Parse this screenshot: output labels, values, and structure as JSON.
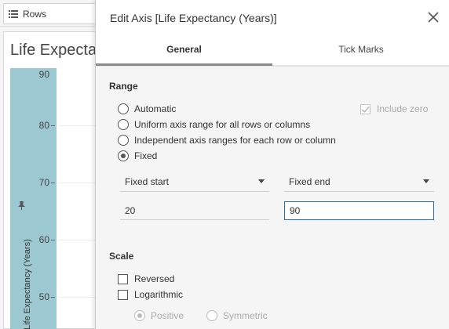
{
  "worksheet": {
    "rows_shelf_label": "Rows",
    "view_title": "Life Expecta",
    "axis_title": "Life Expectancy (Years)",
    "axis_band_color": "#9cc8d2",
    "ticks": [
      "90",
      "80",
      "70",
      "60",
      "50"
    ]
  },
  "dialog": {
    "title": "Edit Axis [Life Expectancy (Years)]",
    "close_icon": "close-icon",
    "tabs": [
      {
        "label": "General",
        "active": true
      },
      {
        "label": "Tick Marks",
        "active": false
      }
    ],
    "range": {
      "heading": "Range",
      "options": [
        {
          "label": "Automatic",
          "checked": false
        },
        {
          "label": "Uniform axis range for all rows or columns",
          "checked": false
        },
        {
          "label": "Independent axis ranges for each row or column",
          "checked": false
        },
        {
          "label": "Fixed",
          "checked": true
        }
      ],
      "include_zero": {
        "label": "Include zero",
        "checked": true,
        "disabled": true
      },
      "start_select": "Fixed start",
      "end_select": "Fixed end",
      "start_value": "20",
      "end_value": "90"
    },
    "scale": {
      "heading": "Scale",
      "reversed": {
        "label": "Reversed",
        "checked": false
      },
      "logarithmic": {
        "label": "Logarithmic",
        "checked": false
      },
      "log_options": [
        {
          "label": "Positive",
          "checked": true,
          "disabled": true
        },
        {
          "label": "Symmetric",
          "checked": false,
          "disabled": true
        }
      ]
    }
  }
}
